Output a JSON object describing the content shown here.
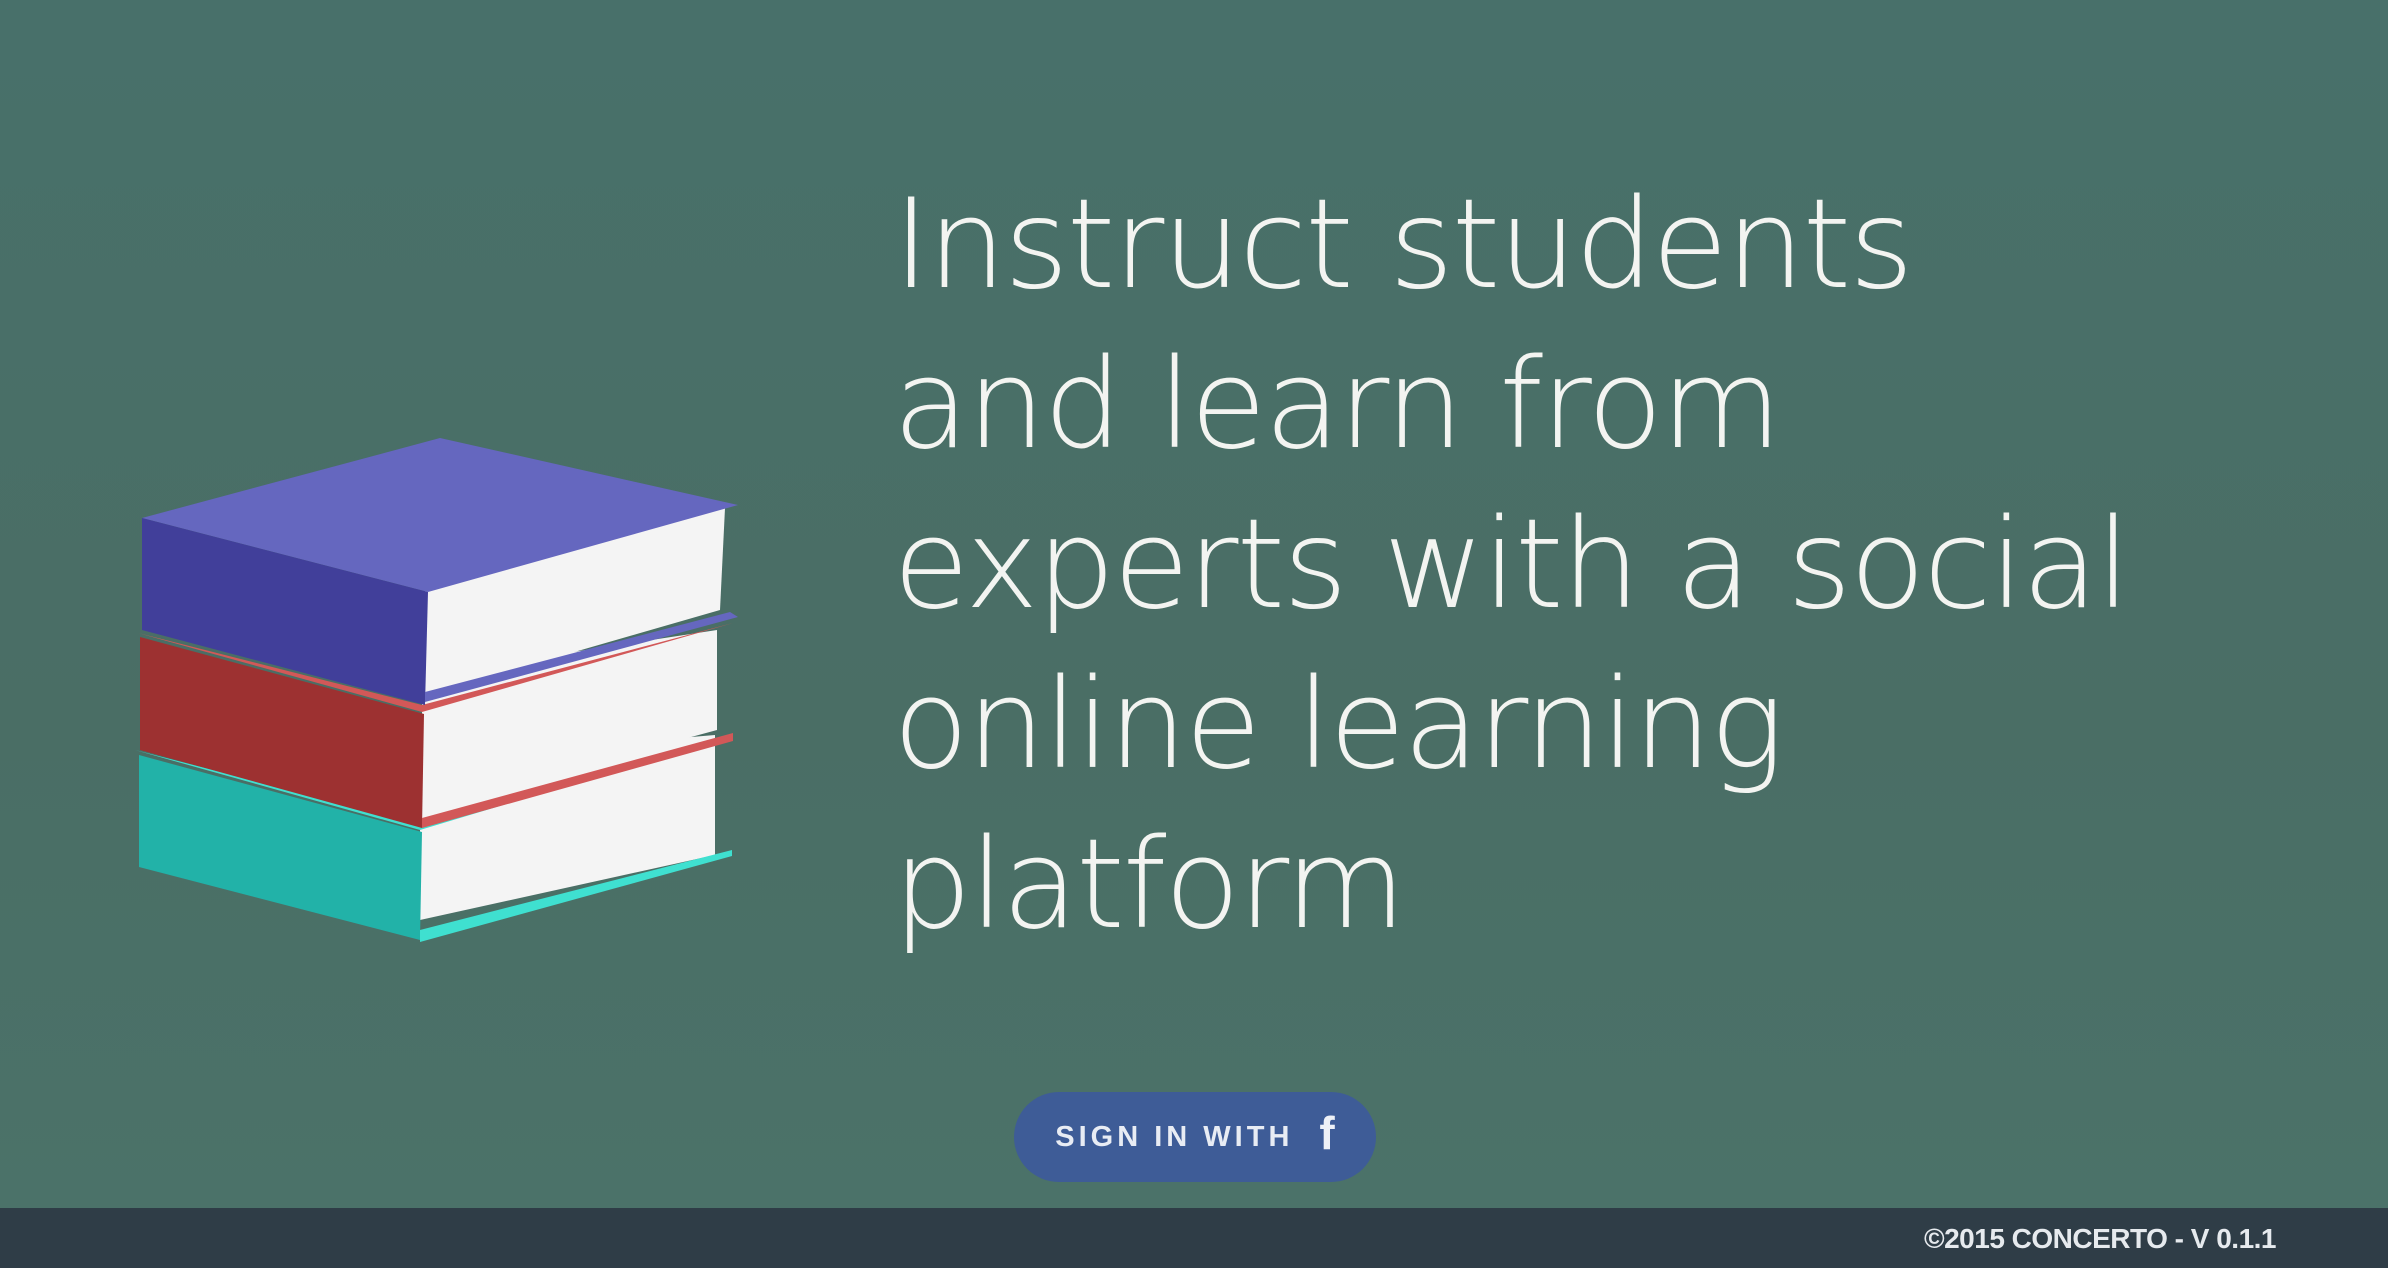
{
  "hero": {
    "headline": "Instruct students\nand learn from\nexperts with a social\nonline learning\nplatform",
    "illustration": "stack-of-books-illustration"
  },
  "signin": {
    "label": "SIGN IN WITH",
    "icon": "facebook-icon",
    "icon_glyph": "f"
  },
  "footer": {
    "copyright": "©2015 CONCERTO - V 0.1.1"
  },
  "colors": {
    "background": "#4a6e65",
    "footer": "#2f3d47",
    "button": "#3e5c97",
    "book_top": "#6567bf",
    "book_top_side": "#413f9a",
    "book_middle_side": "#9d3131",
    "book_middle_edge": "#d25858",
    "book_bottom_side": "#22b2a8",
    "book_bottom_edge": "#3fe0d0",
    "pages": "#f4f4f4"
  }
}
